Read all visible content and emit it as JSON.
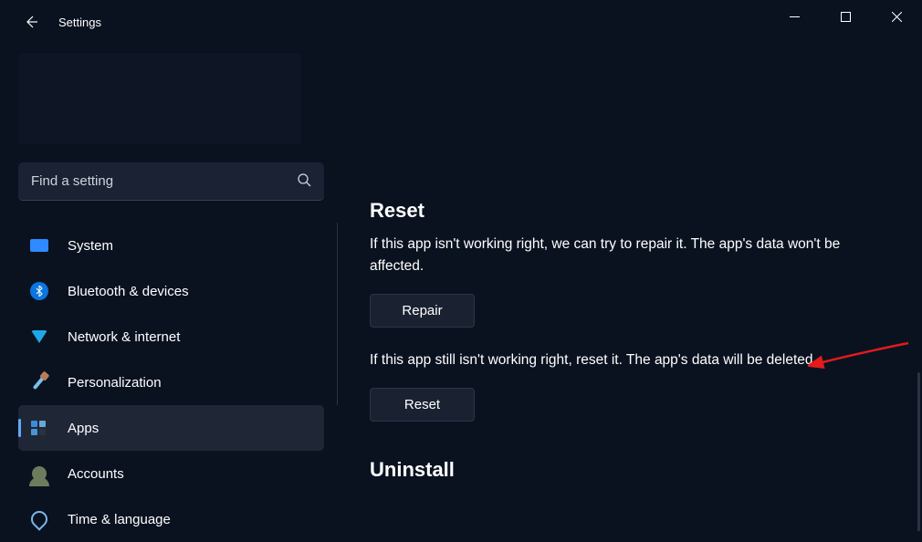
{
  "window": {
    "title": "Settings"
  },
  "search": {
    "placeholder": "Find a setting"
  },
  "sidebar": {
    "items": [
      {
        "label": "System"
      },
      {
        "label": "Bluetooth & devices"
      },
      {
        "label": "Network & internet"
      },
      {
        "label": "Personalization"
      },
      {
        "label": "Apps"
      },
      {
        "label": "Accounts"
      },
      {
        "label": "Time & language"
      }
    ]
  },
  "main": {
    "reset_heading": "Reset",
    "repair_desc": "If this app isn't working right, we can try to repair it. The app's data won't be affected.",
    "repair_button": "Repair",
    "reset_desc": "If this app still isn't working right, reset it. The app's data will be deleted.",
    "reset_button": "Reset",
    "uninstall_heading": "Uninstall"
  }
}
